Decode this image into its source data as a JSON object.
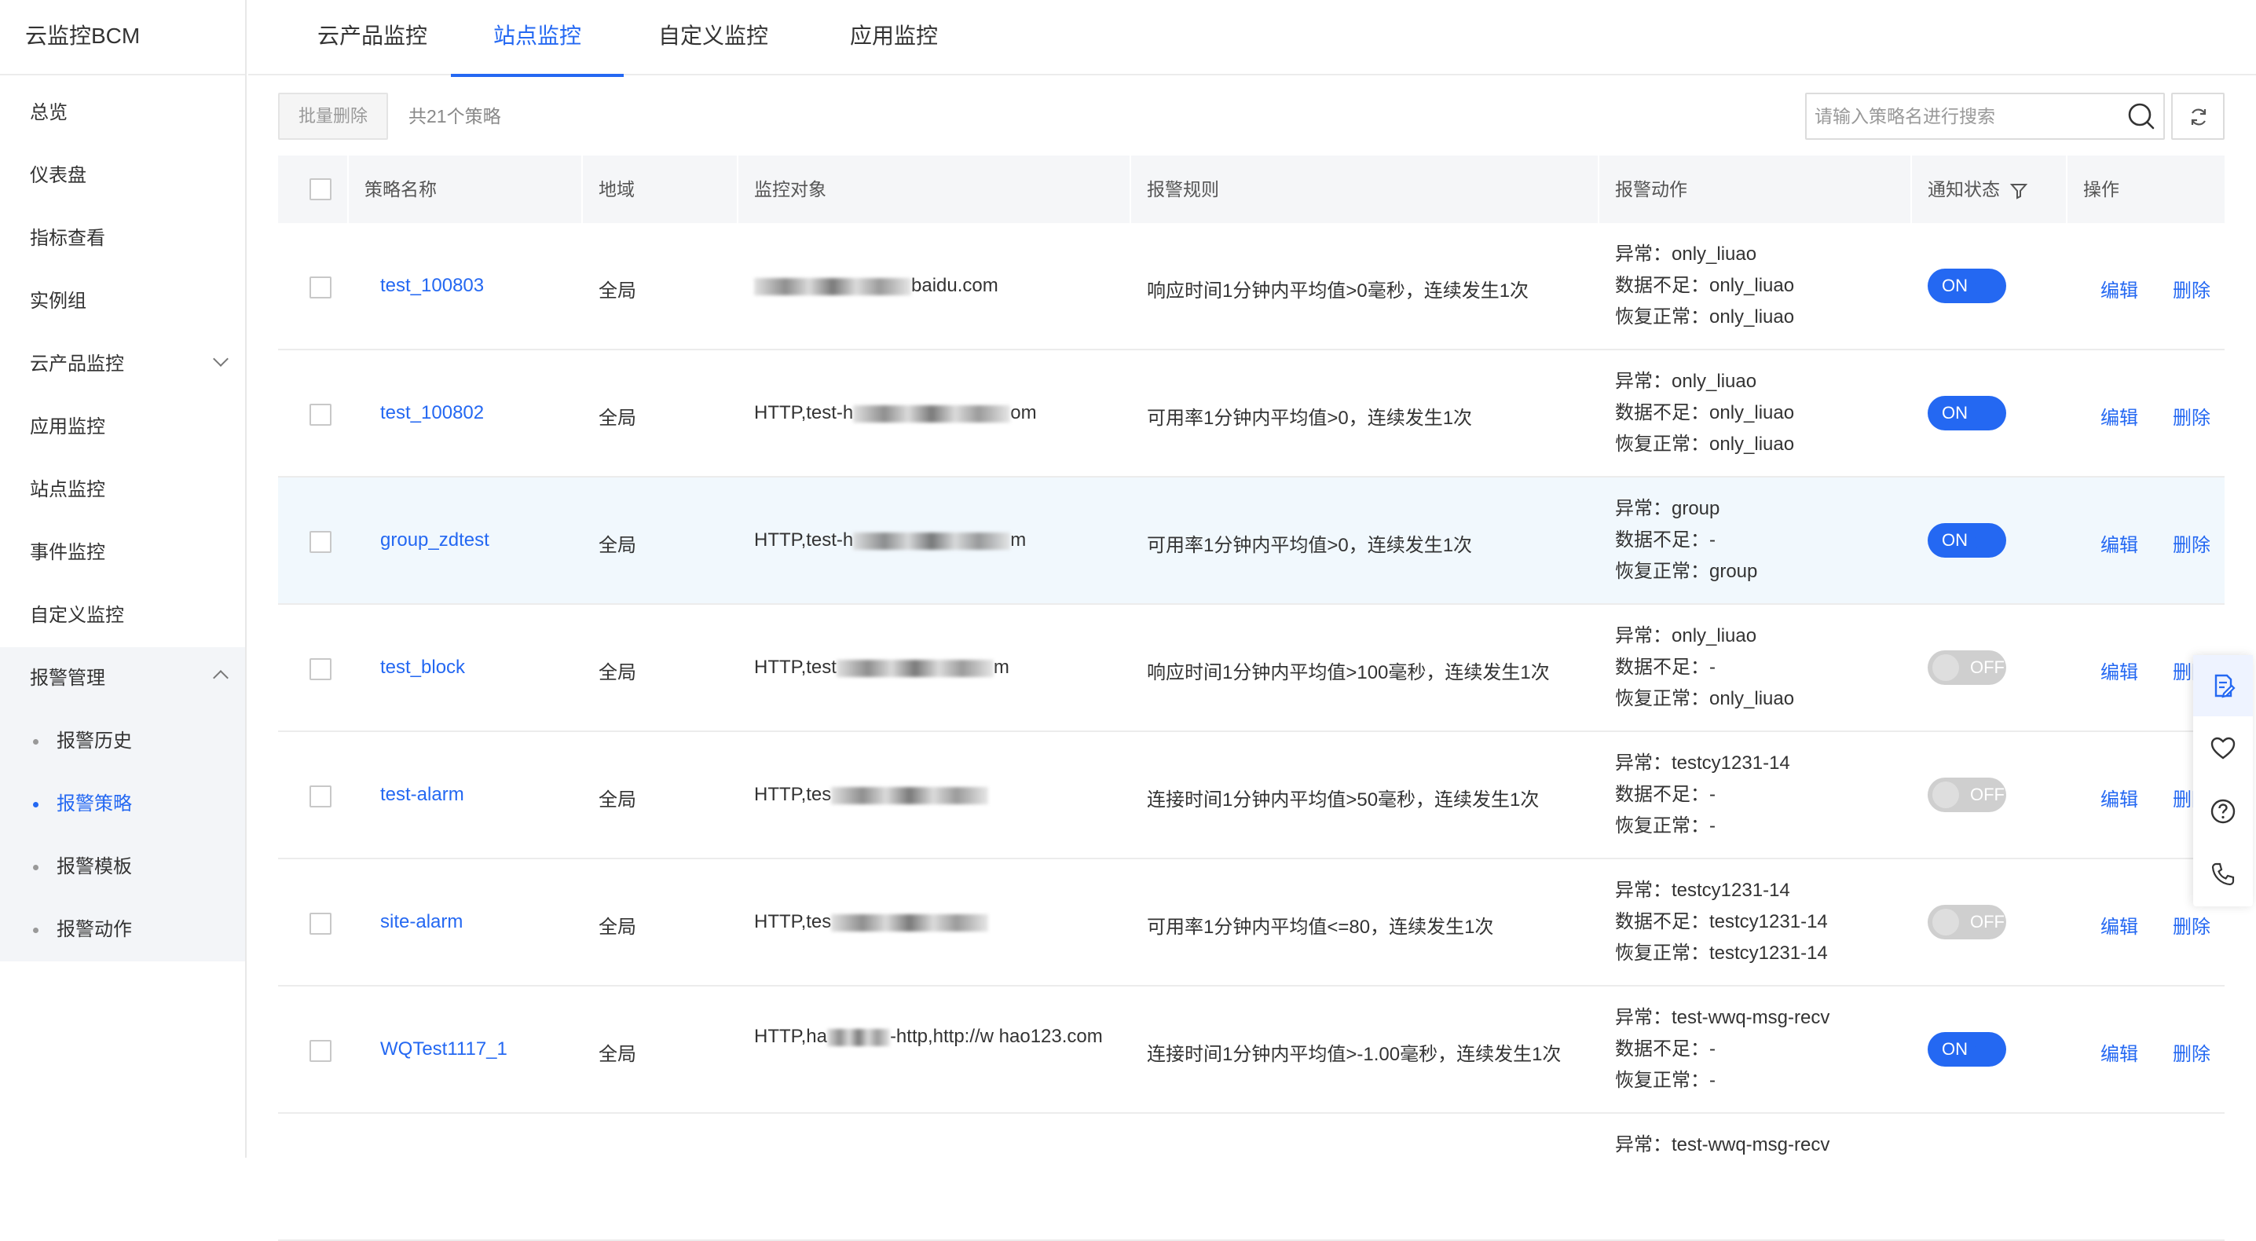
{
  "app": {
    "brand": "云监控BCM"
  },
  "sidebar": {
    "items": [
      {
        "label": "总览"
      },
      {
        "label": "仪表盘"
      },
      {
        "label": "指标查看"
      },
      {
        "label": "实例组"
      },
      {
        "label": "云产品监控",
        "chevron": "chevron-down-icon"
      },
      {
        "label": "应用监控"
      },
      {
        "label": "站点监控"
      },
      {
        "label": "事件监控"
      },
      {
        "label": "自定义监控"
      }
    ],
    "alarm_group": {
      "label": "报警管理",
      "chevron": "chevron-up-icon",
      "children": [
        {
          "label": "报警历史"
        },
        {
          "label": "报警策略",
          "active": true
        },
        {
          "label": "报警模板"
        },
        {
          "label": "报警动作"
        }
      ]
    }
  },
  "tabs": [
    {
      "label": "云产品监控"
    },
    {
      "label": "站点监控",
      "active": true
    },
    {
      "label": "自定义监控"
    },
    {
      "label": "应用监控"
    }
  ],
  "toolbar": {
    "batch_delete": "批量删除",
    "count_text": "共21个策略",
    "search_placeholder": "请输入策略名进行搜索"
  },
  "table": {
    "headers": {
      "name": "策略名称",
      "region": "地域",
      "target": "监控对象",
      "rule": "报警规则",
      "action": "报警动作",
      "status": "通知状态",
      "ops": "操作"
    },
    "op_edit": "编辑",
    "op_delete": "删除",
    "rows": [
      {
        "name": "test_100803",
        "region": "全局",
        "target_pre": "",
        "target_post": "baidu.com",
        "rule": "响应时间1分钟内平均值>0毫秒，连续发生1次",
        "act1": "异常：only_liuao",
        "act2": "数据不足：only_liuao",
        "act3": "恢复正常：only_liuao",
        "status": "ON"
      },
      {
        "name": "test_100802",
        "region": "全局",
        "target_pre": "HTTP,test-h",
        "target_post": "om",
        "rule": "可用率1分钟内平均值>0，连续发生1次",
        "act1": "异常：only_liuao",
        "act2": "数据不足：only_liuao",
        "act3": "恢复正常：only_liuao",
        "status": "ON"
      },
      {
        "name": "group_zdtest",
        "region": "全局",
        "target_pre": "HTTP,test-h",
        "target_post": "m",
        "rule": "可用率1分钟内平均值>0，连续发生1次",
        "act1": "异常：group",
        "act2": "数据不足：-",
        "act3": "恢复正常：group",
        "status": "ON"
      },
      {
        "name": "test_block",
        "region": "全局",
        "target_pre": "HTTP,test",
        "target_post": "m",
        "rule": "响应时间1分钟内平均值>100毫秒，连续发生1次",
        "act1": "异常：only_liuao",
        "act2": "数据不足：-",
        "act3": "恢复正常：only_liuao",
        "status": "OFF"
      },
      {
        "name": "test-alarm",
        "region": "全局",
        "target_pre": "HTTP,tes",
        "target_post": "",
        "rule": "连接时间1分钟内平均值>50毫秒，连续发生1次",
        "act1": "异常：testcy1231-14",
        "act2": "数据不足：-",
        "act3": "恢复正常：-",
        "status": "OFF"
      },
      {
        "name": "site-alarm",
        "region": "全局",
        "target_pre": "HTTP,tes",
        "target_post": "",
        "rule": "可用率1分钟内平均值<=80，连续发生1次",
        "act1": "异常：testcy1231-14",
        "act2": "数据不足：testcy1231-14",
        "act3": "恢复正常：testcy1231-14",
        "status": "OFF"
      },
      {
        "name": "WQTest1117_1",
        "region": "全局",
        "target_pre": "HTTP,ha",
        "target_post": "-http,http://w  hao123.com",
        "rule": "连接时间1分钟内平均值>-1.00毫秒，连续发生1次",
        "act1": "异常：test-wwq-msg-recv",
        "act2": "数据不足：-",
        "act3": "恢复正常：-",
        "status": "ON"
      },
      {
        "name": "",
        "region": "",
        "target_pre": "",
        "target_post": "",
        "rule": "",
        "act1": "异常：test-wwq-msg-recv",
        "act2": "",
        "act3": "",
        "status": ""
      }
    ]
  },
  "float_toolbar": [
    {
      "icon": "document-edit-icon"
    },
    {
      "icon": "heart-icon"
    },
    {
      "icon": "help-circle-icon"
    },
    {
      "icon": "phone-icon"
    }
  ],
  "colors": {
    "accent": "#2468f2",
    "toggle_off": "#cfcfcf",
    "hover_row": "#f1f8fd"
  }
}
